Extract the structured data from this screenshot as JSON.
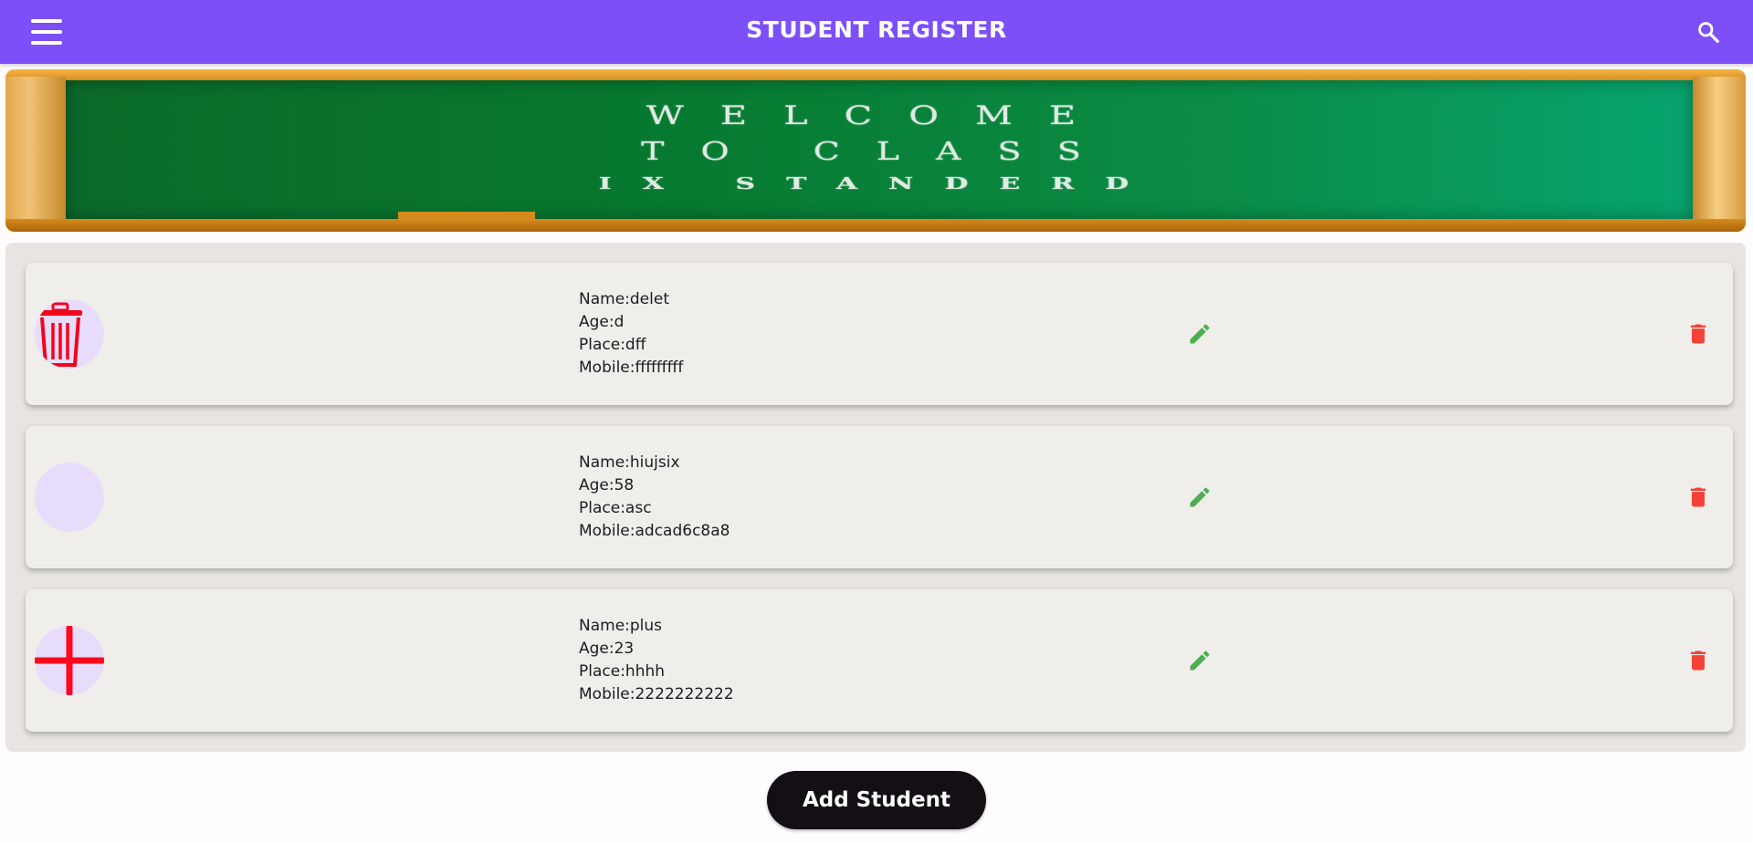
{
  "appbar": {
    "title": "STUDENT REGISTER",
    "color": "#7c4ff8",
    "menu_icon": "menu-icon",
    "search_icon": "search-icon"
  },
  "banner": {
    "line1": "WELCOME",
    "line2": "TO CLASS",
    "line3": "IX STANDERD"
  },
  "students": [
    {
      "avatar_icon": "trash-can-icon",
      "name": "Name:delet",
      "age": "Age:d",
      "place": "Place:dff",
      "mobile": "Mobile:fffffffff"
    },
    {
      "avatar_icon": "sound-wave-icon",
      "name": "Name:hiujsix",
      "age": "Age:58",
      "place": "Place:asc",
      "mobile": "Mobile:adcad6c8a8"
    },
    {
      "avatar_icon": "plus-icon",
      "name": "Name:plus",
      "age": "Age:23",
      "place": "Place:hhhh",
      "mobile": "Mobile:2222222222"
    }
  ],
  "actions": {
    "edit_icon": "pencil-icon",
    "edit_color": "#4caf50",
    "delete_icon": "delete-icon",
    "delete_color": "#f44336"
  },
  "footer": {
    "add_label": "Add Student"
  }
}
